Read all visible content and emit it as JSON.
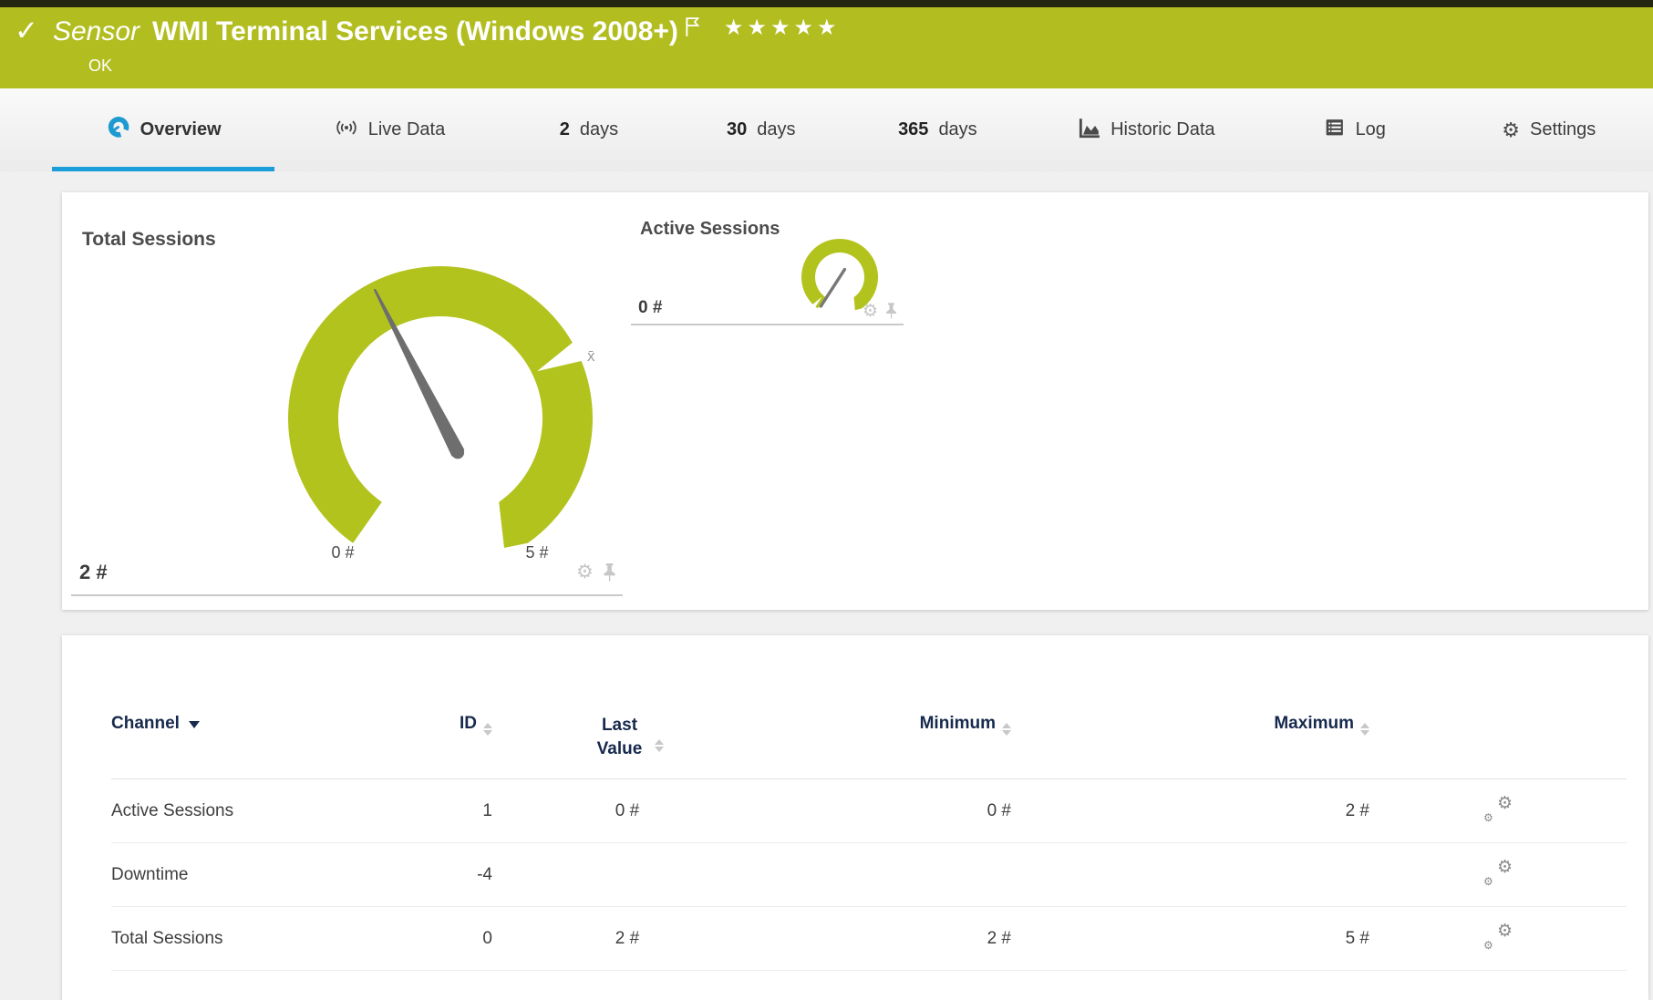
{
  "colors": {
    "banner_green": "#b2bd20",
    "gauge_green": "#b2c31d",
    "tab_active_blue": "#1b9dd9",
    "table_header_navy": "#17294d"
  },
  "banner": {
    "check_icon": "✓",
    "kind": "Sensor",
    "title": "WMI Terminal Services (Windows 2008+)",
    "stars": "★★★★★",
    "status": "OK"
  },
  "tabs": [
    {
      "label": "Overview",
      "icon": "gauge-icon",
      "active": true
    },
    {
      "label": "Live Data",
      "icon": "live-icon"
    },
    {
      "num": "2",
      "label": "days"
    },
    {
      "num": "30",
      "label": "days"
    },
    {
      "num": "365",
      "label": "days"
    },
    {
      "label": "Historic Data",
      "icon": "area-chart-icon"
    },
    {
      "label": "Log",
      "icon": "log-icon"
    },
    {
      "label": "Settings",
      "icon": "gear-icon"
    }
  ],
  "gauges": {
    "total": {
      "title": "Total Sessions",
      "value": "2 #",
      "value_num": 2,
      "scale_min": "0 #",
      "scale_max": "5 #",
      "avg_marker": "x̄"
    },
    "active": {
      "title": "Active Sessions",
      "value": "0 #",
      "value_num": 0
    }
  },
  "icons": {
    "gear": "⚙"
  },
  "table": {
    "columns": [
      {
        "label": "Channel",
        "sorted": "desc"
      },
      {
        "label": "ID"
      },
      {
        "label": "Last Value"
      },
      {
        "label": "Minimum"
      },
      {
        "label": "Maximum"
      }
    ],
    "rows": [
      {
        "channel": "Active Sessions",
        "id": "1",
        "last_value": "0 #",
        "minimum": "0 #",
        "maximum": "2 #"
      },
      {
        "channel": "Downtime",
        "id": "-4",
        "last_value": "",
        "minimum": "",
        "maximum": ""
      },
      {
        "channel": "Total Sessions",
        "id": "0",
        "last_value": "2 #",
        "minimum": "2 #",
        "maximum": "5 #"
      }
    ]
  }
}
